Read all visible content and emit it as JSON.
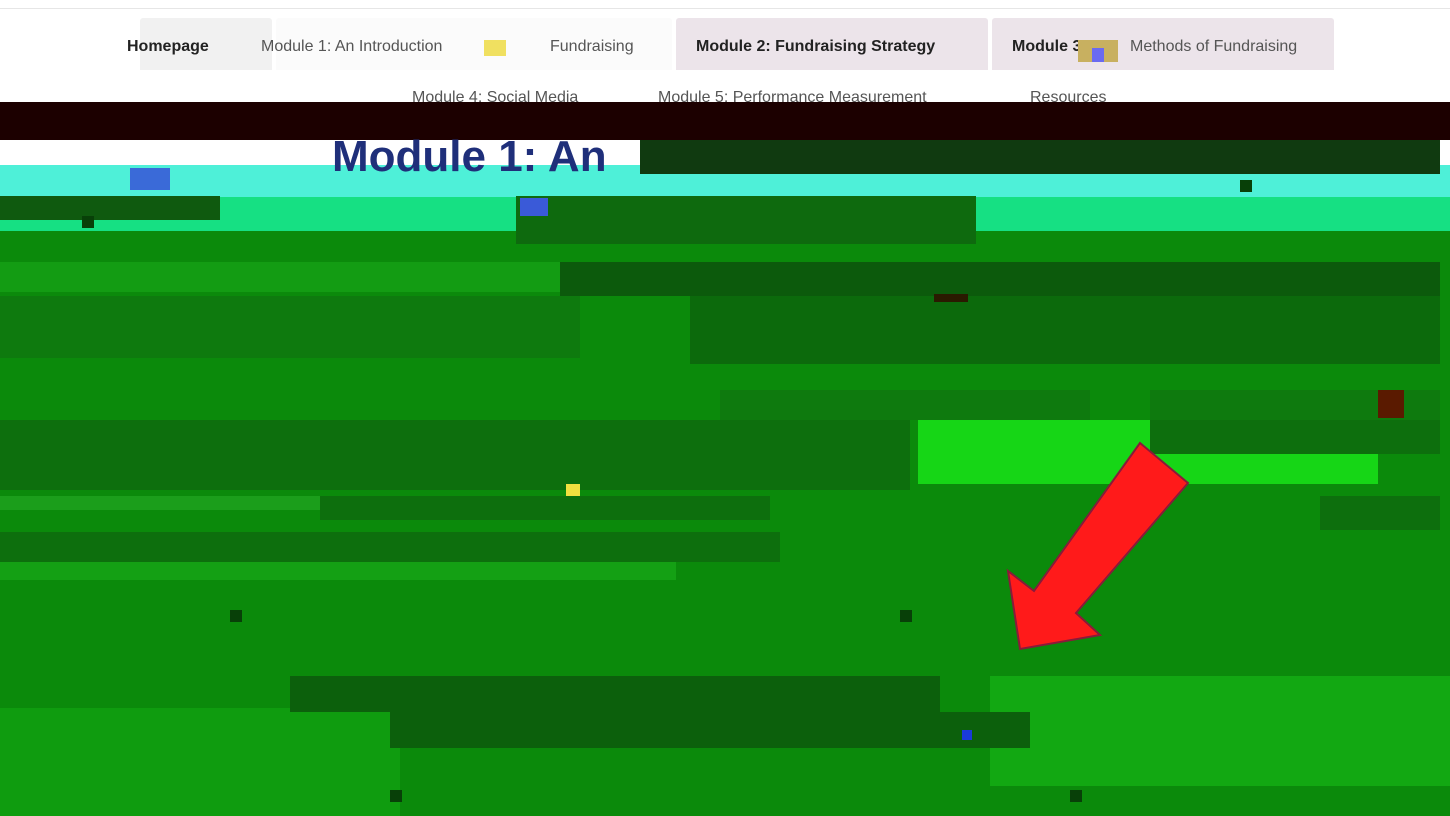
{
  "nav": {
    "row1": [
      {
        "label": "Homepage",
        "active": true
      },
      {
        "label": "Module 1: An Introduction",
        "active": false
      },
      {
        "label": "Fundraising",
        "active": false
      },
      {
        "label": "Module 2: Fundraising Strategy",
        "active": false
      },
      {
        "label": "Module 3:",
        "active": false
      },
      {
        "label": "Methods of Fundraising",
        "active": false
      }
    ],
    "row2": [
      {
        "label": "Module 4: Social Media"
      },
      {
        "label": "Module 5: Performance Measurement"
      },
      {
        "label": "Resources"
      }
    ]
  },
  "page": {
    "title": "Module 1: An"
  },
  "annotation": {
    "arrow_color": "#ff1a1a",
    "arrow_icon": "red-arrow-down-left"
  },
  "colors": {
    "banner_dark": "#1c0000",
    "band_cyan": "#4ef0d8",
    "band_teal": "#16e083",
    "content_green": "#0b8a0b",
    "title_blue": "#1f2f7a"
  }
}
